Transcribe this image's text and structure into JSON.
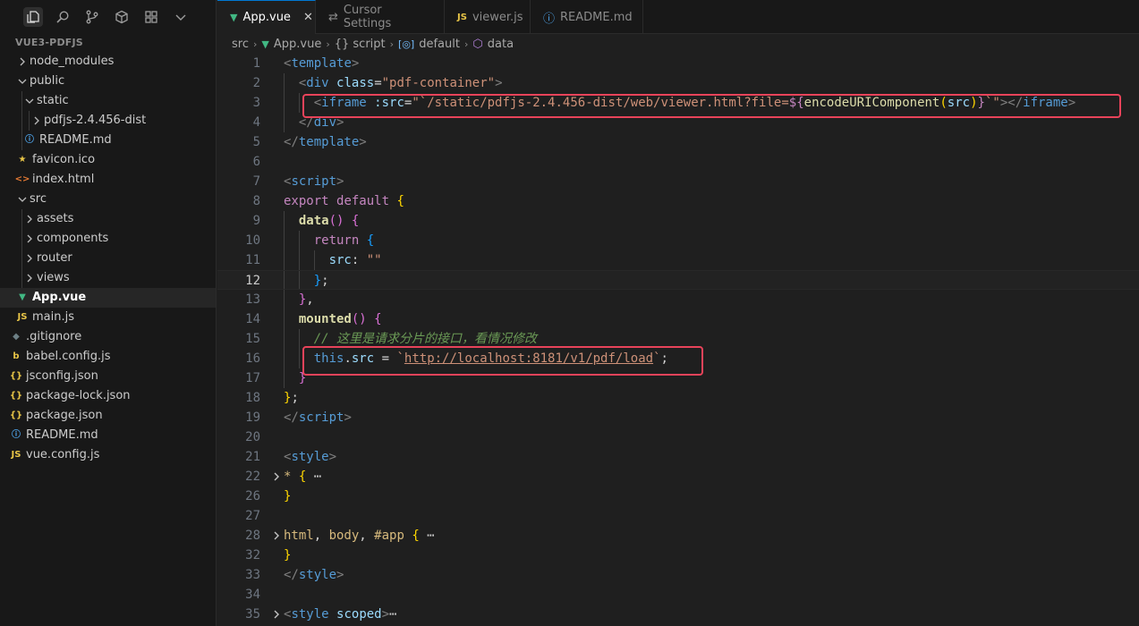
{
  "explorer": {
    "root": "VUE3-PDFJS",
    "items": [
      {
        "label": "node_modules",
        "depth": 0,
        "kind": "folder",
        "state": "closed"
      },
      {
        "label": "public",
        "depth": 0,
        "kind": "folder",
        "state": "open"
      },
      {
        "label": "static",
        "depth": 1,
        "kind": "folder",
        "state": "open"
      },
      {
        "label": "pdfjs-2.4.456-dist",
        "depth": 2,
        "kind": "folder",
        "state": "closed"
      },
      {
        "label": "README.md",
        "depth": 1,
        "kind": "info"
      },
      {
        "label": "favicon.ico",
        "depth": 0,
        "kind": "star"
      },
      {
        "label": "index.html",
        "depth": 0,
        "kind": "html"
      },
      {
        "label": "src",
        "depth": 0,
        "kind": "folder",
        "state": "open"
      },
      {
        "label": "assets",
        "depth": 1,
        "kind": "folder",
        "state": "closed"
      },
      {
        "label": "components",
        "depth": 1,
        "kind": "folder",
        "state": "closed"
      },
      {
        "label": "router",
        "depth": 1,
        "kind": "folder",
        "state": "closed"
      },
      {
        "label": "views",
        "depth": 1,
        "kind": "folder",
        "state": "closed"
      },
      {
        "label": "App.vue",
        "depth": 0,
        "kind": "vue",
        "selected": true
      },
      {
        "label": "main.js",
        "depth": 0,
        "kind": "js"
      },
      {
        "label": ".gitignore",
        "depth": -1,
        "kind": "git"
      },
      {
        "label": "babel.config.js",
        "depth": -1,
        "kind": "babel"
      },
      {
        "label": "jsconfig.json",
        "depth": -1,
        "kind": "json"
      },
      {
        "label": "package-lock.json",
        "depth": -1,
        "kind": "json"
      },
      {
        "label": "package.json",
        "depth": -1,
        "kind": "json"
      },
      {
        "label": "README.md",
        "depth": -1,
        "kind": "info"
      },
      {
        "label": "vue.config.js",
        "depth": -1,
        "kind": "js"
      }
    ]
  },
  "icons": {
    "js": "JS",
    "json": "{}",
    "info": "ⓘ",
    "star": "★",
    "html": "<>",
    "vue": "▼",
    "git": "◆",
    "babel": "b"
  },
  "tabs": [
    {
      "label": "App.vue",
      "icon": "vue",
      "active": true,
      "close": "✕"
    },
    {
      "label": "Cursor Settings",
      "icon": "settings"
    },
    {
      "label": "viewer.js",
      "icon": "js"
    },
    {
      "label": "README.md",
      "icon": "info"
    }
  ],
  "breadcrumb": [
    "src",
    "App.vue",
    "{} script",
    "default",
    "data"
  ],
  "code": {
    "current_line": 12,
    "lines": [
      {
        "n": 1,
        "indent": 0,
        "tokens": [
          [
            "tag",
            "<"
          ],
          [
            "tn",
            "template"
          ],
          [
            "tag",
            ">"
          ]
        ]
      },
      {
        "n": 2,
        "indent": 1,
        "tokens": [
          [
            "tag",
            "<"
          ],
          [
            "tn",
            "div"
          ],
          [
            "pl",
            " "
          ],
          [
            "at",
            "class"
          ],
          [
            "pl",
            "="
          ],
          [
            "str",
            "\"pdf-container\""
          ],
          [
            "tag",
            ">"
          ]
        ]
      },
      {
        "n": 3,
        "indent": 2,
        "tokens": [
          [
            "tag",
            "<"
          ],
          [
            "tn",
            "iframe"
          ],
          [
            "pl",
            " "
          ],
          [
            "at",
            ":src"
          ],
          [
            "pl",
            "="
          ],
          [
            "str",
            "\""
          ],
          [
            "str",
            "`/static/pdfjs-2.4.456-dist/web/viewer.html?file="
          ],
          [
            "kw2",
            "${"
          ],
          [
            "fn",
            "encodeURIComponent"
          ],
          [
            "b1",
            "("
          ],
          [
            "prop",
            "src"
          ],
          [
            "b1",
            ")"
          ],
          [
            "kw2",
            "}"
          ],
          [
            "str",
            "`"
          ],
          [
            "str",
            "\""
          ],
          [
            "tag",
            "></"
          ],
          [
            "tn",
            "iframe"
          ],
          [
            "tag",
            ">"
          ]
        ]
      },
      {
        "n": 4,
        "indent": 1,
        "tokens": [
          [
            "tag",
            "</"
          ],
          [
            "tn",
            "div"
          ],
          [
            "tag",
            ">"
          ]
        ]
      },
      {
        "n": 5,
        "indent": 0,
        "tokens": [
          [
            "tag",
            "</"
          ],
          [
            "tn",
            "template"
          ],
          [
            "tag",
            ">"
          ]
        ]
      },
      {
        "n": 6,
        "indent": 0,
        "tokens": []
      },
      {
        "n": 7,
        "indent": 0,
        "tokens": [
          [
            "tag",
            "<"
          ],
          [
            "tn",
            "script"
          ],
          [
            "tag",
            ">"
          ]
        ]
      },
      {
        "n": 8,
        "indent": 0,
        "tokens": [
          [
            "kw2",
            "export"
          ],
          [
            "pl",
            " "
          ],
          [
            "kw2",
            "default"
          ],
          [
            "pl",
            " "
          ],
          [
            "b1",
            "{"
          ]
        ]
      },
      {
        "n": 9,
        "indent": 1,
        "tokens": [
          [
            "fnb",
            "data"
          ],
          [
            "b2",
            "()"
          ],
          [
            "pl",
            " "
          ],
          [
            "b2",
            "{"
          ]
        ]
      },
      {
        "n": 10,
        "indent": 2,
        "tokens": [
          [
            "kw2",
            "return"
          ],
          [
            "pl",
            " "
          ],
          [
            "b3",
            "{"
          ]
        ]
      },
      {
        "n": 11,
        "indent": 3,
        "tokens": [
          [
            "prop",
            "src"
          ],
          [
            "pl",
            ": "
          ],
          [
            "str",
            "\"\""
          ]
        ]
      },
      {
        "n": 12,
        "indent": 2,
        "tokens": [
          [
            "b3",
            "}"
          ],
          [
            "pl",
            ";"
          ]
        ]
      },
      {
        "n": 13,
        "indent": 1,
        "tokens": [
          [
            "b2",
            "}"
          ],
          [
            "pl",
            ","
          ]
        ]
      },
      {
        "n": 14,
        "indent": 1,
        "tokens": [
          [
            "fnb",
            "mounted"
          ],
          [
            "b2",
            "()"
          ],
          [
            "pl",
            " "
          ],
          [
            "b2",
            "{"
          ]
        ]
      },
      {
        "n": 15,
        "indent": 2,
        "tokens": [
          [
            "cm",
            "// 这里是请求分片的接口，看情况修改"
          ]
        ]
      },
      {
        "n": 16,
        "indent": 2,
        "tokens": [
          [
            "kw",
            "this"
          ],
          [
            "pl",
            "."
          ],
          [
            "prop",
            "src"
          ],
          [
            "pl",
            " = "
          ],
          [
            "str",
            "`"
          ],
          [
            "url",
            "http://localhost:8181/v1/pdf/load"
          ],
          [
            "str",
            "`"
          ],
          [
            "pl",
            ";"
          ]
        ]
      },
      {
        "n": 17,
        "indent": 1,
        "tokens": [
          [
            "b2",
            "}"
          ]
        ]
      },
      {
        "n": 18,
        "indent": 0,
        "tokens": [
          [
            "b1",
            "}"
          ],
          [
            "pl",
            ";"
          ]
        ]
      },
      {
        "n": 19,
        "indent": 0,
        "tokens": [
          [
            "tag",
            "</"
          ],
          [
            "tn",
            "script"
          ],
          [
            "tag",
            ">"
          ]
        ]
      },
      {
        "n": 20,
        "indent": 0,
        "tokens": []
      },
      {
        "n": 21,
        "indent": 0,
        "tokens": [
          [
            "tag",
            "<"
          ],
          [
            "tn",
            "style"
          ],
          [
            "tag",
            ">"
          ]
        ]
      },
      {
        "n": 22,
        "indent": 0,
        "fold": true,
        "tokens": [
          [
            "sel",
            "*"
          ],
          [
            "pl",
            " "
          ],
          [
            "b1",
            "{"
          ],
          [
            "ell",
            " ⋯"
          ]
        ]
      },
      {
        "n": 26,
        "indent": 0,
        "tokens": [
          [
            "b1",
            "}"
          ]
        ]
      },
      {
        "n": 27,
        "indent": 0,
        "tokens": []
      },
      {
        "n": 28,
        "indent": 0,
        "fold": true,
        "tokens": [
          [
            "sel",
            "html"
          ],
          [
            "pl",
            ", "
          ],
          [
            "sel",
            "body"
          ],
          [
            "pl",
            ", "
          ],
          [
            "sel",
            "#app"
          ],
          [
            "pl",
            " "
          ],
          [
            "b1",
            "{"
          ],
          [
            "ell",
            " ⋯"
          ]
        ]
      },
      {
        "n": 32,
        "indent": 0,
        "tokens": [
          [
            "b1",
            "}"
          ]
        ]
      },
      {
        "n": 33,
        "indent": 0,
        "tokens": [
          [
            "tag",
            "</"
          ],
          [
            "tn",
            "style"
          ],
          [
            "tag",
            ">"
          ]
        ]
      },
      {
        "n": 34,
        "indent": 0,
        "tokens": []
      },
      {
        "n": 35,
        "indent": 0,
        "fold": true,
        "tokens": [
          [
            "tag",
            "<"
          ],
          [
            "tn",
            "style"
          ],
          [
            "pl",
            " "
          ],
          [
            "at",
            "scoped"
          ],
          [
            "tag",
            ">"
          ],
          [
            "ell",
            "⋯"
          ]
        ]
      }
    ]
  },
  "colors": {
    "highlight_box": "#e8435a",
    "active_tab_border": "#0078d4"
  }
}
